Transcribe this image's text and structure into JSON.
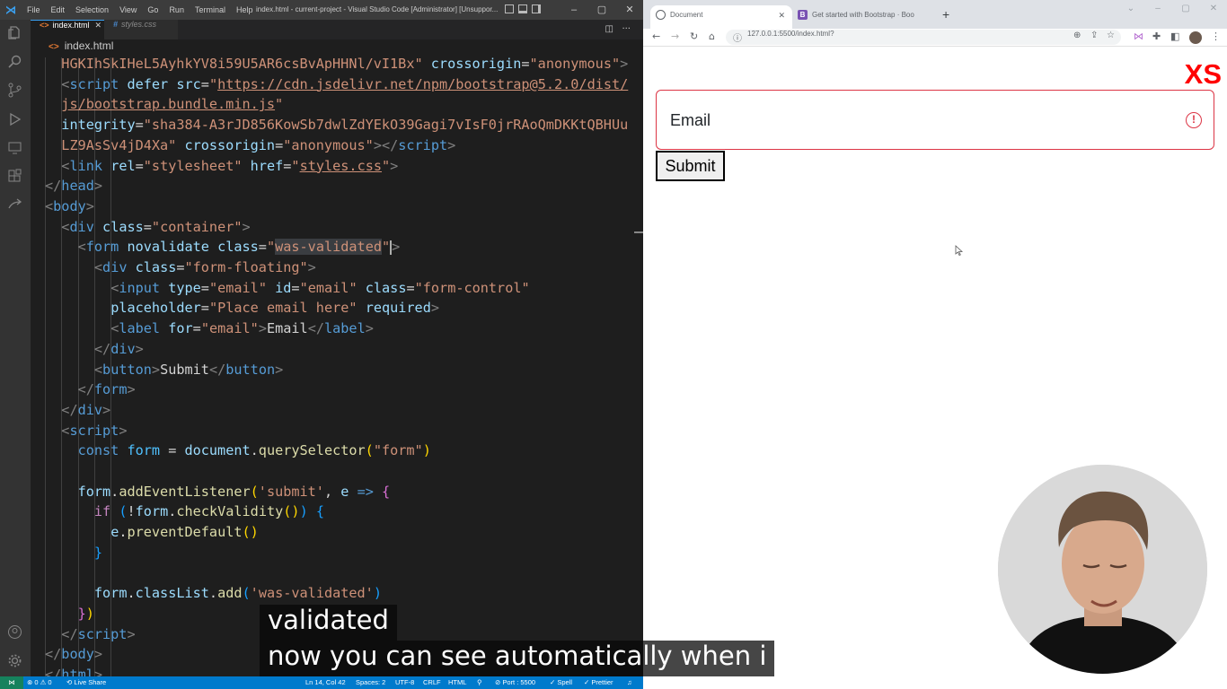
{
  "vscode": {
    "menu": [
      "File",
      "Edit",
      "Selection",
      "View",
      "Go",
      "Run",
      "Terminal",
      "Help"
    ],
    "window_title": "index.html - current-project - Visual Studio Code [Administrator] [Unsuppor...",
    "tabs": [
      {
        "label": "index.html",
        "icon": "html-file-icon",
        "close": "✕"
      },
      {
        "label": "styles.css",
        "icon": "css-file-icon"
      }
    ],
    "breadcrumb": {
      "file": "index.html"
    },
    "editor": {
      "lines": [
        [
          [
            "t-str",
            "HGKIhSkIHeL5AyhkYV8i59U5AR6csBvApHHNl/vI1Bx\""
          ],
          [
            "t-txt",
            " "
          ],
          [
            "t-attr",
            "crossorigin"
          ],
          [
            "t-txt",
            "="
          ],
          [
            "t-str",
            "\"anonymous\""
          ],
          [
            "t-br",
            ">"
          ]
        ],
        [
          [
            "t-br",
            "<"
          ],
          [
            "t-tag",
            "script"
          ],
          [
            "t-txt",
            " "
          ],
          [
            "t-attr",
            "defer"
          ],
          [
            "t-txt",
            " "
          ],
          [
            "t-attr",
            "src"
          ],
          [
            "t-txt",
            "="
          ],
          [
            "t-str",
            "\""
          ],
          [
            "t-link",
            "https://cdn.jsdelivr.net/npm/bootstrap@5.2.0/dist/"
          ]
        ],
        [
          [
            "t-link",
            "js/bootstrap.bundle.min.js"
          ],
          [
            "t-str",
            "\""
          ]
        ],
        [
          [
            "t-attr",
            "integrity"
          ],
          [
            "t-txt",
            "="
          ],
          [
            "t-str",
            "\"sha384-A3rJD856KowSb7dwlZdYEkO39Gagi7vIsF0jrRAoQmDKKtQBHUu"
          ]
        ],
        [
          [
            "t-str",
            "LZ9AsSv4jD4Xa\""
          ],
          [
            "t-txt",
            " "
          ],
          [
            "t-attr",
            "crossorigin"
          ],
          [
            "t-txt",
            "="
          ],
          [
            "t-str",
            "\"anonymous\""
          ],
          [
            "t-br",
            "></"
          ],
          [
            "t-tag",
            "script"
          ],
          [
            "t-br",
            ">"
          ]
        ],
        [
          [
            "t-br",
            "<"
          ],
          [
            "t-tag",
            "link"
          ],
          [
            "t-txt",
            " "
          ],
          [
            "t-attr",
            "rel"
          ],
          [
            "t-txt",
            "="
          ],
          [
            "t-str",
            "\"stylesheet\""
          ],
          [
            "t-txt",
            " "
          ],
          [
            "t-attr",
            "href"
          ],
          [
            "t-txt",
            "="
          ],
          [
            "t-str",
            "\""
          ],
          [
            "t-link",
            "styles.css"
          ],
          [
            "t-str",
            "\""
          ],
          [
            "t-br",
            ">"
          ]
        ],
        [
          [
            "t-br",
            "</"
          ],
          [
            "t-tag",
            "head"
          ],
          [
            "t-br",
            ">"
          ]
        ],
        [
          [
            "t-br",
            "<"
          ],
          [
            "t-tag",
            "body"
          ],
          [
            "t-br",
            ">"
          ]
        ],
        [
          [
            "t-br",
            "<"
          ],
          [
            "t-tag",
            "div"
          ],
          [
            "t-txt",
            " "
          ],
          [
            "t-attr",
            "class"
          ],
          [
            "t-txt",
            "="
          ],
          [
            "t-str",
            "\"container\""
          ],
          [
            "t-br",
            ">"
          ]
        ],
        [
          [
            "t-br",
            "<"
          ],
          [
            "t-tag",
            "form"
          ],
          [
            "t-txt",
            " "
          ],
          [
            "t-attr",
            "novalidate"
          ],
          [
            "t-txt",
            " "
          ],
          [
            "t-attr",
            "class"
          ],
          [
            "t-txt",
            "="
          ],
          [
            "t-str",
            "\""
          ],
          [
            "t-str sel-word",
            "was-validated"
          ],
          [
            "t-str",
            "\""
          ],
          [
            "cursor",
            ""
          ],
          [
            "t-br",
            ">"
          ]
        ],
        [
          [
            "t-br",
            "<"
          ],
          [
            "t-tag",
            "div"
          ],
          [
            "t-txt",
            " "
          ],
          [
            "t-attr",
            "class"
          ],
          [
            "t-txt",
            "="
          ],
          [
            "t-str",
            "\"form-floating\""
          ],
          [
            "t-br",
            ">"
          ]
        ],
        [
          [
            "t-br",
            "<"
          ],
          [
            "t-tag",
            "input"
          ],
          [
            "t-txt",
            " "
          ],
          [
            "t-attr",
            "type"
          ],
          [
            "t-txt",
            "="
          ],
          [
            "t-str",
            "\"email\""
          ],
          [
            "t-txt",
            " "
          ],
          [
            "t-attr",
            "id"
          ],
          [
            "t-txt",
            "="
          ],
          [
            "t-str",
            "\"email\""
          ],
          [
            "t-txt",
            " "
          ],
          [
            "t-attr",
            "class"
          ],
          [
            "t-txt",
            "="
          ],
          [
            "t-str",
            "\"form-control\""
          ]
        ],
        [
          [
            "t-attr",
            "placeholder"
          ],
          [
            "t-txt",
            "="
          ],
          [
            "t-str",
            "\"Place email here\""
          ],
          [
            "t-txt",
            " "
          ],
          [
            "t-attr",
            "required"
          ],
          [
            "t-br",
            ">"
          ]
        ],
        [
          [
            "t-br",
            "<"
          ],
          [
            "t-tag",
            "label"
          ],
          [
            "t-txt",
            " "
          ],
          [
            "t-attr",
            "for"
          ],
          [
            "t-txt",
            "="
          ],
          [
            "t-str",
            "\"email\""
          ],
          [
            "t-br",
            ">"
          ],
          [
            "t-txt",
            "Email"
          ],
          [
            "t-br",
            "</"
          ],
          [
            "t-tag",
            "label"
          ],
          [
            "t-br",
            ">"
          ]
        ],
        [
          [
            "t-br",
            "</"
          ],
          [
            "t-tag",
            "div"
          ],
          [
            "t-br",
            ">"
          ]
        ],
        [
          [
            "t-br",
            "<"
          ],
          [
            "t-tag",
            "button"
          ],
          [
            "t-br",
            ">"
          ],
          [
            "t-txt",
            "Submit"
          ],
          [
            "t-br",
            "</"
          ],
          [
            "t-tag",
            "button"
          ],
          [
            "t-br",
            ">"
          ]
        ],
        [
          [
            "t-br",
            "</"
          ],
          [
            "t-tag",
            "form"
          ],
          [
            "t-br",
            ">"
          ]
        ],
        [
          [
            "t-br",
            "</"
          ],
          [
            "t-tag",
            "div"
          ],
          [
            "t-br",
            ">"
          ]
        ],
        [
          [
            "t-br",
            "<"
          ],
          [
            "t-tag",
            "script"
          ],
          [
            "t-br",
            ">"
          ]
        ],
        [
          [
            "t-kw",
            "const"
          ],
          [
            "t-txt",
            " "
          ],
          [
            "t-var",
            "form"
          ],
          [
            "t-txt",
            " = "
          ],
          [
            "t-id",
            "document"
          ],
          [
            "t-txt",
            "."
          ],
          [
            "t-fn",
            "querySelector"
          ],
          [
            "t-p1",
            "("
          ],
          [
            "t-str",
            "\"form\""
          ],
          [
            "t-p1",
            ")"
          ]
        ],
        [],
        [
          [
            "t-id",
            "form"
          ],
          [
            "t-txt",
            "."
          ],
          [
            "t-fn",
            "addEventListener"
          ],
          [
            "t-p1",
            "("
          ],
          [
            "t-str",
            "'submit'"
          ],
          [
            "t-txt",
            ", "
          ],
          [
            "t-id",
            "e"
          ],
          [
            "t-txt",
            " "
          ],
          [
            "t-kw",
            "=>"
          ],
          [
            "t-txt",
            " "
          ],
          [
            "t-p2",
            "{"
          ]
        ],
        [
          [
            "t-ctl",
            "if"
          ],
          [
            "t-txt",
            " "
          ],
          [
            "t-p3",
            "("
          ],
          [
            "t-txt",
            "!"
          ],
          [
            "t-id",
            "form"
          ],
          [
            "t-txt",
            "."
          ],
          [
            "t-fn",
            "checkValidity"
          ],
          [
            "t-p1",
            "()"
          ],
          [
            "t-p3",
            ")"
          ],
          [
            "t-txt",
            " "
          ],
          [
            "t-p3",
            "{"
          ]
        ],
        [
          [
            "t-id",
            "e"
          ],
          [
            "t-txt",
            "."
          ],
          [
            "t-fn",
            "preventDefault"
          ],
          [
            "t-p1",
            "()"
          ]
        ],
        [
          [
            "t-p3",
            "}"
          ]
        ],
        [],
        [
          [
            "t-id",
            "form"
          ],
          [
            "t-txt",
            "."
          ],
          [
            "t-id",
            "classList"
          ],
          [
            "t-txt",
            "."
          ],
          [
            "t-fn",
            "add"
          ],
          [
            "t-p3",
            "("
          ],
          [
            "t-str",
            "'was-validated'"
          ],
          [
            "t-p3",
            ")"
          ]
        ],
        [
          [
            "t-p2",
            "}"
          ],
          [
            "t-p1",
            ")"
          ]
        ],
        [
          [
            "t-br",
            "</"
          ],
          [
            "t-tag",
            "script"
          ],
          [
            "t-br",
            ">"
          ]
        ],
        [
          [
            "t-br",
            "</"
          ],
          [
            "t-tag",
            "body"
          ],
          [
            "t-br",
            ">"
          ]
        ],
        [
          [
            "t-br",
            "</"
          ],
          [
            "t-tag",
            "html"
          ],
          [
            "t-br",
            ">"
          ]
        ]
      ]
    },
    "status": {
      "remote": "⋈",
      "problems": "⊗ 0 ⚠ 0",
      "live_share": "Live Share",
      "position": "Ln 14, Col 42",
      "spaces": "Spaces: 2",
      "encoding": "UTF-8",
      "eol": "CRLF",
      "language": "HTML",
      "port": "Port : 5500",
      "spell": "Spell",
      "prettier": "Prettier"
    }
  },
  "browser": {
    "tabs": [
      {
        "title": "Document",
        "active": true
      },
      {
        "title": "Get started with Bootstrap · Boo",
        "active": false
      }
    ],
    "url": "127.0.0.1:5500/index.html?",
    "page": {
      "breakpoint_label": "XS",
      "email_label": "Email",
      "submit_label": "Submit"
    }
  },
  "captions": [
    "validated",
    "now you can see automatically when i"
  ],
  "colors": {
    "vscode_accent": "#007acc",
    "invalid": "#dc3545",
    "breakpoint": "#ff0000"
  }
}
